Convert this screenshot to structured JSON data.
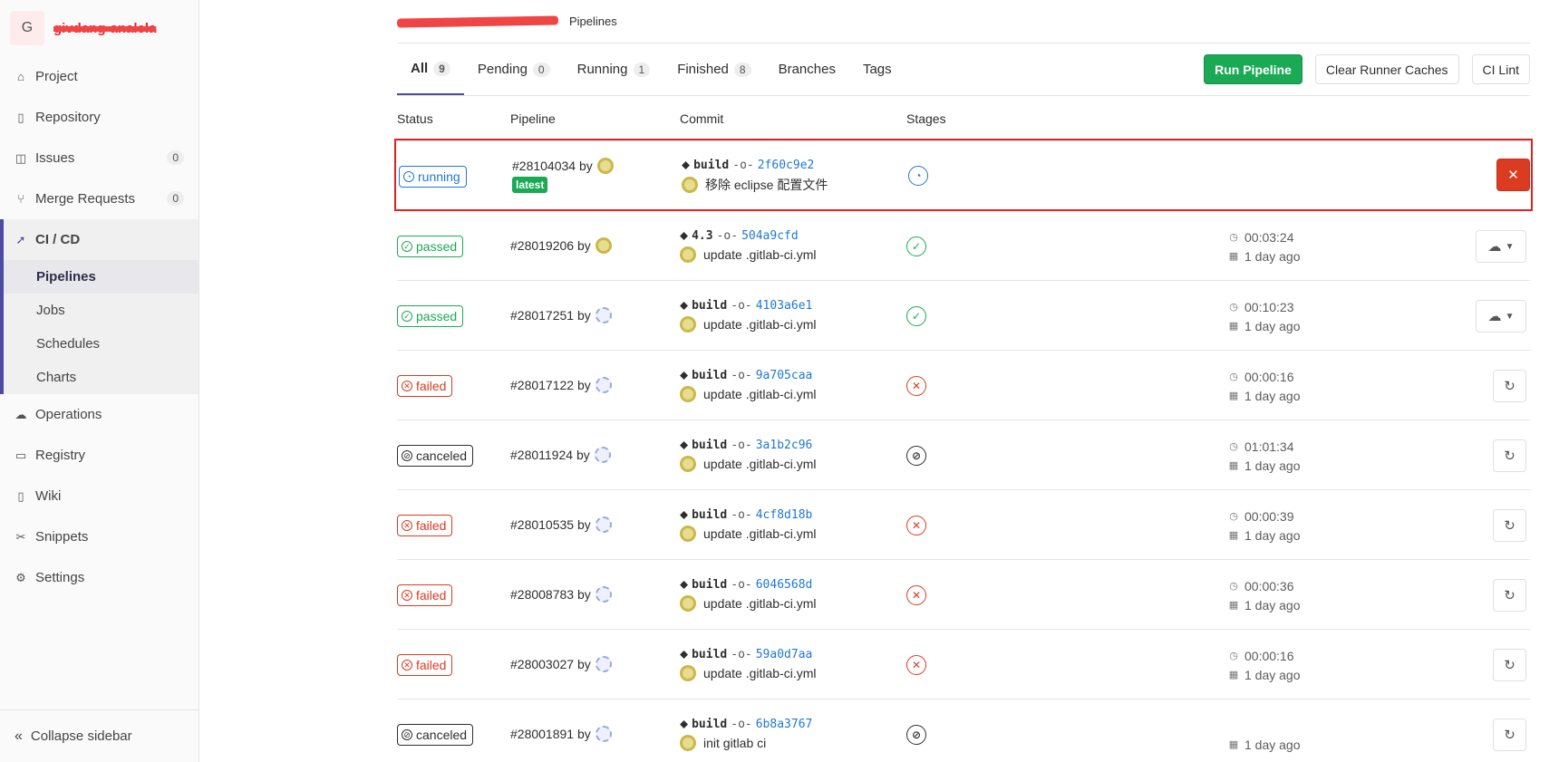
{
  "sidebar": {
    "project_letter": "G",
    "project_name": "givdang-analela",
    "items": [
      {
        "label": "Project",
        "icon": "home-icon"
      },
      {
        "label": "Repository",
        "icon": "book-icon"
      },
      {
        "label": "Issues",
        "icon": "issues-icon",
        "count": "0"
      },
      {
        "label": "Merge Requests",
        "icon": "merge-icon",
        "count": "0"
      },
      {
        "label": "CI / CD",
        "icon": "rocket-icon"
      }
    ],
    "cicd_sub": [
      "Pipelines",
      "Jobs",
      "Schedules",
      "Charts"
    ],
    "items_bottom": [
      {
        "label": "Operations",
        "icon": "cloud-icon"
      },
      {
        "label": "Registry",
        "icon": "disk-icon"
      },
      {
        "label": "Wiki",
        "icon": "book-icon"
      },
      {
        "label": "Snippets",
        "icon": "scissors-icon"
      },
      {
        "label": "Settings",
        "icon": "gear-icon"
      }
    ],
    "collapse_label": "Collapse sidebar"
  },
  "breadcrumb": {
    "current": "Pipelines"
  },
  "tabs": [
    {
      "label": "All",
      "count": "9"
    },
    {
      "label": "Pending",
      "count": "0"
    },
    {
      "label": "Running",
      "count": "1"
    },
    {
      "label": "Finished",
      "count": "8"
    },
    {
      "label": "Branches"
    },
    {
      "label": "Tags"
    }
  ],
  "actions": {
    "run": "Run Pipeline",
    "clear": "Clear Runner Caches",
    "lint": "CI Lint"
  },
  "columns": {
    "status": "Status",
    "pipeline": "Pipeline",
    "commit": "Commit",
    "stages": "Stages"
  },
  "rows": [
    {
      "status": "running",
      "id": "#28104034",
      "by": "by",
      "latest": "latest",
      "ref_icon": "tag-icon",
      "ref": "build",
      "sha": "2f60c9e2",
      "msg": "移除 eclipse 配置文件",
      "duration": "",
      "when": ""
    },
    {
      "status": "passed",
      "id": "#28019206",
      "by": "by",
      "ref_icon": "tag-icon",
      "ref": "4.3",
      "sha": "504a9cfd",
      "msg": "update .gitlab-ci.yml",
      "duration": "00:03:24",
      "when": "1 day ago"
    },
    {
      "status": "passed",
      "id": "#28017251",
      "by": "by",
      "ref_icon": "tag-icon",
      "ref": "build",
      "sha": "4103a6e1",
      "msg": "update .gitlab-ci.yml",
      "duration": "00:10:23",
      "when": "1 day ago"
    },
    {
      "status": "failed",
      "id": "#28017122",
      "by": "by",
      "ref_icon": "tag-icon",
      "ref": "build",
      "sha": "9a705caa",
      "msg": "update .gitlab-ci.yml",
      "duration": "00:00:16",
      "when": "1 day ago"
    },
    {
      "status": "canceled",
      "id": "#28011924",
      "by": "by",
      "ref_icon": "tag-icon",
      "ref": "build",
      "sha": "3a1b2c96",
      "msg": "update .gitlab-ci.yml",
      "duration": "01:01:34",
      "when": "1 day ago"
    },
    {
      "status": "failed",
      "id": "#28010535",
      "by": "by",
      "ref_icon": "tag-icon",
      "ref": "build",
      "sha": "4cf8d18b",
      "msg": "update .gitlab-ci.yml",
      "duration": "00:00:39",
      "when": "1 day ago"
    },
    {
      "status": "failed",
      "id": "#28008783",
      "by": "by",
      "ref_icon": "tag-icon",
      "ref": "build",
      "sha": "6046568d",
      "msg": "update .gitlab-ci.yml",
      "duration": "00:00:36",
      "when": "1 day ago"
    },
    {
      "status": "failed",
      "id": "#28003027",
      "by": "by",
      "ref_icon": "tag-icon",
      "ref": "build",
      "sha": "59a0d7aa",
      "msg": "update .gitlab-ci.yml",
      "duration": "00:00:16",
      "when": "1 day ago"
    },
    {
      "status": "canceled",
      "id": "#28001891",
      "by": "by",
      "ref_icon": "tag-icon",
      "ref": "build",
      "sha": "6b8a3767",
      "msg": "init gitlab ci",
      "duration": "",
      "when": "1 day ago"
    }
  ],
  "colors": {
    "accent": "#4b4ba3",
    "green": "#1aaa55",
    "red": "#db3b21",
    "blue": "#1f78d1"
  }
}
